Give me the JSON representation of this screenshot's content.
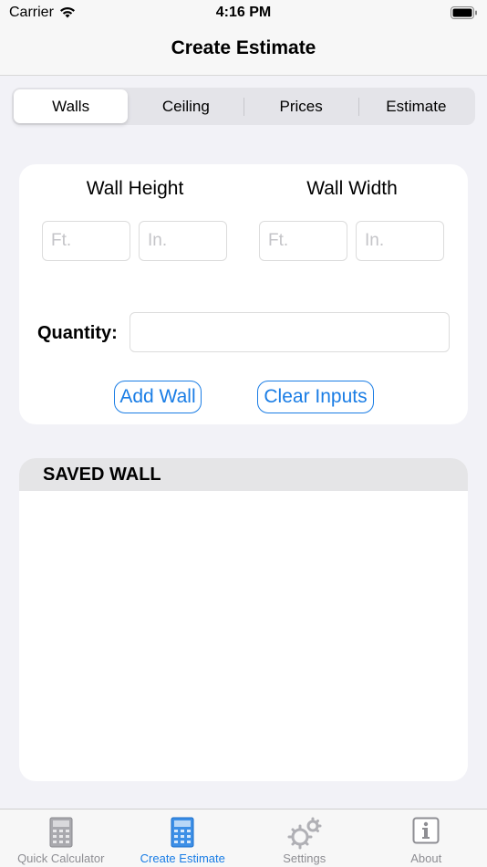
{
  "status": {
    "carrier": "Carrier",
    "time": "4:16 PM"
  },
  "nav": {
    "title": "Create Estimate"
  },
  "segments": {
    "items": [
      {
        "label": "Walls",
        "selected": true
      },
      {
        "label": "Ceiling",
        "selected": false
      },
      {
        "label": "Prices",
        "selected": false
      },
      {
        "label": "Estimate",
        "selected": false
      }
    ]
  },
  "form": {
    "height_label": "Wall Height",
    "width_label": "Wall Width",
    "height_ft_placeholder": "Ft.",
    "height_in_placeholder": "In.",
    "width_ft_placeholder": "Ft.",
    "width_in_placeholder": "In.",
    "quantity_label": "Quantity:",
    "quantity_value": "",
    "add_button": "Add Wall",
    "clear_button": "Clear Inputs"
  },
  "saved": {
    "header": "SAVED WALL"
  },
  "tabs": {
    "items": [
      {
        "label": "Quick Calculator",
        "icon": "calculator-icon",
        "active": false
      },
      {
        "label": "Create Estimate",
        "icon": "calculator-blue-icon",
        "active": true
      },
      {
        "label": "Settings",
        "icon": "gears-icon",
        "active": false
      },
      {
        "label": "About",
        "icon": "info-icon",
        "active": false
      }
    ]
  },
  "colors": {
    "accent": "#1a7de5",
    "background": "#f2f2f7",
    "inactive_tab": "#8e8e93"
  }
}
